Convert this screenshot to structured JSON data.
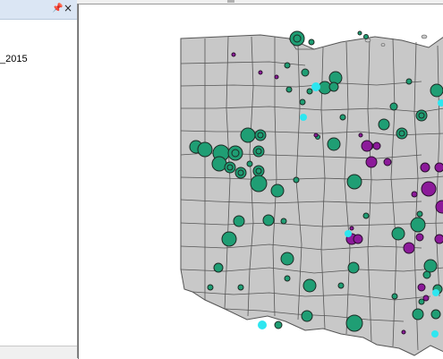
{
  "toc": {
    "pin_glyph": "Ũ",
    "close_glyph": "×",
    "layer_name": "_2015",
    "icons": {
      "pin": "pin-icon",
      "close": "close-icon"
    }
  },
  "map": {
    "colors": {
      "state_fill": "#c8c8c8",
      "county_border": "#555555",
      "green": "#1f9e74",
      "purple": "#8c1a9a",
      "cyan": "#2ee6f0",
      "water": "#ffffff"
    }
  }
}
